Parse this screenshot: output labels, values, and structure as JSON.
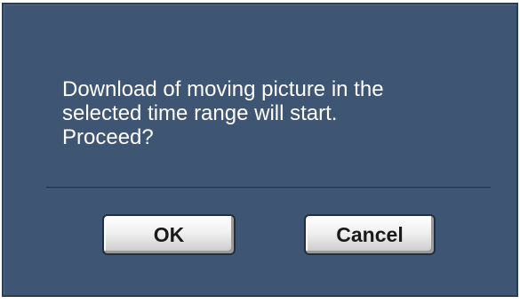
{
  "dialog": {
    "message": "Download of moving picture in the\nselected time range will start.\nProceed?",
    "ok_label": "OK",
    "cancel_label": "Cancel"
  },
  "colors": {
    "dialog_background": "#3e5574",
    "text": "#ffffff",
    "button_face": "#e6e6e6"
  }
}
